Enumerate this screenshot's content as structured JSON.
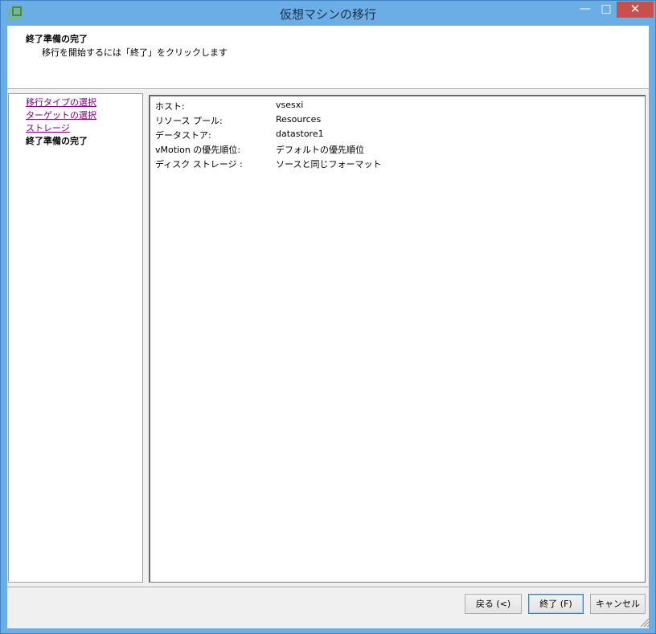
{
  "window": {
    "title": "仮想マシンの移行",
    "minimize_glyph": "—",
    "maximize_glyph": "□",
    "close_glyph": "✕",
    "accent_color": "#6aaee5",
    "close_color": "#c7504a"
  },
  "header": {
    "title": "終了準備の完了",
    "subtitle": "移行を開始するには「終了」をクリックします"
  },
  "nav": {
    "items": [
      {
        "label": "移行タイプの選択",
        "state": "visited"
      },
      {
        "label": "ターゲットの選択",
        "state": "visited"
      },
      {
        "label": "ストレージ",
        "state": "visited"
      },
      {
        "label": "終了準備の完了",
        "state": "current"
      }
    ]
  },
  "summary": {
    "rows": [
      {
        "label": "ホスト:",
        "value": "vsesxi"
      },
      {
        "label": "リソース プール:",
        "value": "Resources"
      },
      {
        "label": "データストア:",
        "value": "datastore1"
      },
      {
        "label": "vMotion の優先順位:",
        "value": "デフォルトの優先順位"
      },
      {
        "label": "ディスク ストレージ :",
        "value": "ソースと同じフォーマット"
      }
    ]
  },
  "footer": {
    "back_label": "戻る (<)",
    "finish_label": "終了 (F)",
    "cancel_label": "キャンセル"
  },
  "icons": {
    "app": "vm-migrate-icon",
    "grip": "resize-grip-icon"
  }
}
